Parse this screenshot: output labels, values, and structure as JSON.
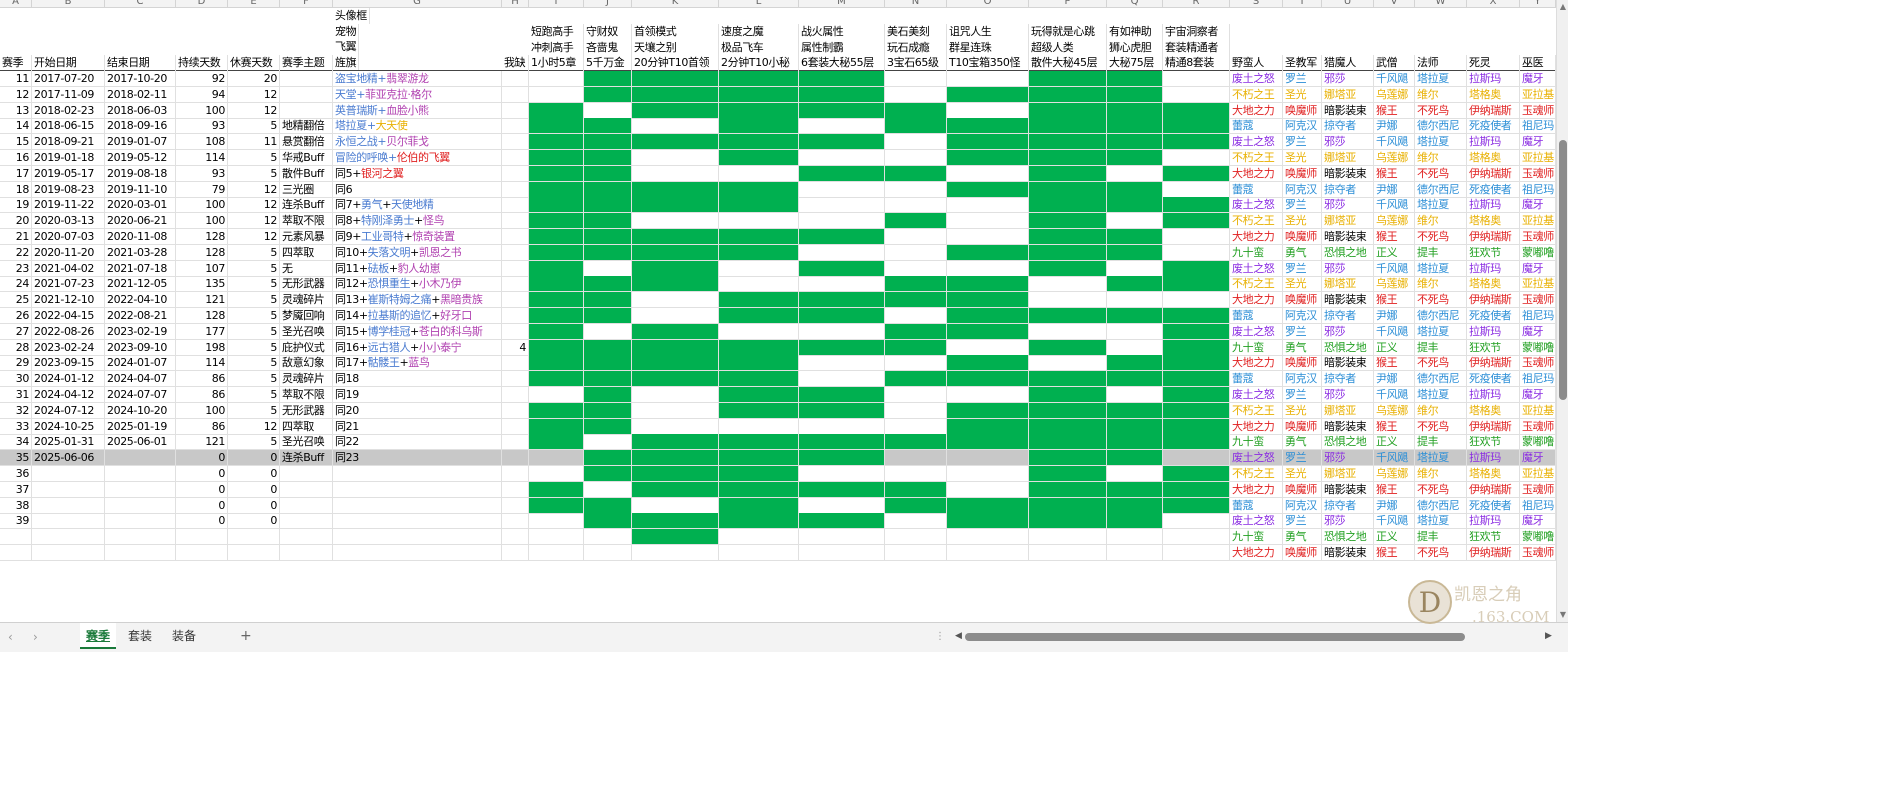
{
  "column_letters": [
    "",
    "A",
    "B",
    "C",
    "D",
    "E",
    "F",
    "G",
    "H",
    "I",
    "J",
    "K",
    "L",
    "M",
    "N",
    "O",
    "P",
    "Q",
    "R",
    "S",
    "T",
    "U",
    "V",
    "W",
    "X",
    "Y"
  ],
  "header_stack": {
    "top": {
      "text": "头像框",
      "color": "#4a7bd0"
    },
    "mid1": {
      "text": "宠物",
      "color": "#b040b0"
    },
    "mid2": {
      "text": "飞翼",
      "color": "#e02020"
    },
    "bottom": {
      "text": "旌旗",
      "color": "#e8b000"
    }
  },
  "headers": {
    "A": "赛季",
    "B": "开始日期",
    "C": "结束日期",
    "D": "持续天数",
    "E": "休赛天数",
    "F": "赛季主题",
    "H": "我缺",
    "I": [
      "短跑高手",
      "冲刺高手",
      "1小时5章"
    ],
    "J": [
      "守财奴",
      "吝啬鬼",
      "5千万金"
    ],
    "K": [
      "首领模式",
      "天壤之别",
      "20分钟T10首领"
    ],
    "L": [
      "速度之魔",
      "极品飞车",
      "2分钟T10小秘"
    ],
    "M": [
      "战火属性",
      "属性制霸",
      "6套装大秘55层"
    ],
    "N": [
      "美石美刻",
      "玩石成瘾",
      "3宝石65级"
    ],
    "O": [
      "诅咒人生",
      "群星连珠",
      "T10宝箱350怪"
    ],
    "P": [
      "玩得就是心跳",
      "超级人类",
      "散件大秘45层"
    ],
    "Q": [
      "有如神助",
      "狮心虎胆",
      "大秘75层"
    ],
    "R": [
      "宇宙洞察者",
      "套装精通者",
      "精通8套装"
    ],
    "S": "野蛮人",
    "T": "圣教军",
    "U": "猎魔人",
    "V": "武僧",
    "W": "法师",
    "X": "死灵",
    "Y": "巫医"
  },
  "rows": [
    {
      "no": "11",
      "start": "2017-07-20",
      "end": "2017-10-20",
      "dur": "92",
      "rest": "20",
      "theme": "",
      "rew": [
        {
          "t": "盗宝地精",
          "c": "#4a7bd0"
        },
        {
          "t": "+",
          "c": "#4a7bd0"
        },
        {
          "t": "翡翠游龙",
          "c": "#b040b0"
        }
      ],
      "h": ""
    },
    {
      "no": "12",
      "start": "2017-11-09",
      "end": "2018-02-11",
      "dur": "94",
      "rest": "12",
      "theme": "",
      "rew": [
        {
          "t": "天堂",
          "c": "#4a7bd0"
        },
        {
          "t": "+",
          "c": "#4a7bd0"
        },
        {
          "t": "菲亚克拉·格尔",
          "c": "#b040b0"
        }
      ],
      "h": ""
    },
    {
      "no": "13",
      "start": "2018-02-23",
      "end": "2018-06-03",
      "dur": "100",
      "rest": "12",
      "theme": "",
      "rew": [
        {
          "t": "英普瑞斯",
          "c": "#4a7bd0"
        },
        {
          "t": "+",
          "c": "#4a7bd0"
        },
        {
          "t": "血脸小熊",
          "c": "#b040b0"
        }
      ],
      "h": ""
    },
    {
      "no": "14",
      "start": "2018-06-15",
      "end": "2018-09-16",
      "dur": "93",
      "rest": "5",
      "theme": "地精翻倍",
      "rew": [
        {
          "t": "塔拉夏",
          "c": "#4a7bd0"
        },
        {
          "t": "+",
          "c": "#4a7bd0"
        },
        {
          "t": "大天使",
          "c": "#e8b000"
        }
      ],
      "h": ""
    },
    {
      "no": "15",
      "start": "2018-09-21",
      "end": "2019-01-07",
      "dur": "108",
      "rest": "11",
      "theme": "悬赏翻倍",
      "rew": [
        {
          "t": "永恒之战",
          "c": "#4a7bd0"
        },
        {
          "t": "+",
          "c": "#4a7bd0"
        },
        {
          "t": "贝尔菲戈",
          "c": "#b040b0"
        }
      ],
      "h": ""
    },
    {
      "no": "16",
      "start": "2019-01-18",
      "end": "2019-05-12",
      "dur": "114",
      "rest": "5",
      "theme": "华戒Buff",
      "rew": [
        {
          "t": "冒险的呼唤",
          "c": "#4a7bd0"
        },
        {
          "t": "+",
          "c": "#4a7bd0"
        },
        {
          "t": "伦伯的飞翼",
          "c": "#e02020"
        }
      ],
      "h": ""
    },
    {
      "no": "17",
      "start": "2019-05-17",
      "end": "2019-08-18",
      "dur": "93",
      "rest": "5",
      "theme": "散件Buff",
      "rew": [
        {
          "t": "同5",
          "c": "#000"
        },
        {
          "t": "+",
          "c": "#000"
        },
        {
          "t": "银河之翼",
          "c": "#e02020"
        }
      ],
      "h": ""
    },
    {
      "no": "18",
      "start": "2019-08-23",
      "end": "2019-11-10",
      "dur": "79",
      "rest": "12",
      "theme": "三光圈",
      "rew": [
        {
          "t": "同6",
          "c": "#000"
        }
      ],
      "h": ""
    },
    {
      "no": "19",
      "start": "2019-11-22",
      "end": "2020-03-01",
      "dur": "100",
      "rest": "12",
      "theme": "连杀Buff",
      "rew": [
        {
          "t": "同7",
          "c": "#000"
        },
        {
          "t": "+",
          "c": "#000"
        },
        {
          "t": "勇气",
          "c": "#4a7bd0"
        },
        {
          "t": "+",
          "c": "#000"
        },
        {
          "t": "天使地精",
          "c": "#4a7bd0"
        }
      ],
      "h": ""
    },
    {
      "no": "20",
      "start": "2020-03-13",
      "end": "2020-06-21",
      "dur": "100",
      "rest": "12",
      "theme": "萃取不限",
      "rew": [
        {
          "t": "同8",
          "c": "#000"
        },
        {
          "t": "+",
          "c": "#000"
        },
        {
          "t": "特刚泽勇士",
          "c": "#4a7bd0"
        },
        {
          "t": "+",
          "c": "#000"
        },
        {
          "t": "怪鸟",
          "c": "#b040b0"
        }
      ],
      "h": ""
    },
    {
      "no": "21",
      "start": "2020-07-03",
      "end": "2020-11-08",
      "dur": "128",
      "rest": "12",
      "theme": "元素风暴",
      "rew": [
        {
          "t": "同9",
          "c": "#000"
        },
        {
          "t": "+",
          "c": "#000"
        },
        {
          "t": "工业哥特",
          "c": "#4a7bd0"
        },
        {
          "t": "+",
          "c": "#000"
        },
        {
          "t": "惊奇装置",
          "c": "#b040b0"
        }
      ],
      "h": ""
    },
    {
      "no": "22",
      "start": "2020-11-20",
      "end": "2021-03-28",
      "dur": "128",
      "rest": "5",
      "theme": "四萃取",
      "rew": [
        {
          "t": "同10",
          "c": "#000"
        },
        {
          "t": "+",
          "c": "#000"
        },
        {
          "t": "失落文明",
          "c": "#4a7bd0"
        },
        {
          "t": "+",
          "c": "#000"
        },
        {
          "t": "凯恩之书",
          "c": "#b040b0"
        }
      ],
      "h": ""
    },
    {
      "no": "23",
      "start": "2021-04-02",
      "end": "2021-07-18",
      "dur": "107",
      "rest": "5",
      "theme": "无",
      "rew": [
        {
          "t": "同11",
          "c": "#000"
        },
        {
          "t": "+",
          "c": "#000"
        },
        {
          "t": "砝板",
          "c": "#4a7bd0"
        },
        {
          "t": "+",
          "c": "#000"
        },
        {
          "t": "豹人幼崽",
          "c": "#b040b0"
        }
      ],
      "h": ""
    },
    {
      "no": "24",
      "start": "2021-07-23",
      "end": "2021-12-05",
      "dur": "135",
      "rest": "5",
      "theme": "无形武器",
      "rew": [
        {
          "t": "同12",
          "c": "#000"
        },
        {
          "t": "+",
          "c": "#000"
        },
        {
          "t": "恐惧重生",
          "c": "#4a7bd0"
        },
        {
          "t": "+",
          "c": "#000"
        },
        {
          "t": "小木乃伊",
          "c": "#b040b0"
        }
      ],
      "h": ""
    },
    {
      "no": "25",
      "start": "2021-12-10",
      "end": "2022-04-10",
      "dur": "121",
      "rest": "5",
      "theme": "灵魂碎片",
      "rew": [
        {
          "t": "同13",
          "c": "#000"
        },
        {
          "t": "+",
          "c": "#000"
        },
        {
          "t": "崔斯特姆之痛",
          "c": "#4a7bd0"
        },
        {
          "t": "+",
          "c": "#000"
        },
        {
          "t": "黑暗贵族",
          "c": "#b040b0"
        }
      ],
      "h": ""
    },
    {
      "no": "26",
      "start": "2022-04-15",
      "end": "2022-08-21",
      "dur": "128",
      "rest": "5",
      "theme": "梦魇回响",
      "rew": [
        {
          "t": "同14",
          "c": "#000"
        },
        {
          "t": "+",
          "c": "#000"
        },
        {
          "t": "拉基斯的追忆",
          "c": "#4a7bd0"
        },
        {
          "t": "+",
          "c": "#000"
        },
        {
          "t": "好牙口",
          "c": "#b040b0"
        }
      ],
      "h": ""
    },
    {
      "no": "27",
      "start": "2022-08-26",
      "end": "2023-02-19",
      "dur": "177",
      "rest": "5",
      "theme": "圣光召唤",
      "rew": [
        {
          "t": "同15",
          "c": "#000"
        },
        {
          "t": "+",
          "c": "#000"
        },
        {
          "t": "博学桂冠",
          "c": "#4a7bd0"
        },
        {
          "t": "+",
          "c": "#000"
        },
        {
          "t": "苍白的科乌斯",
          "c": "#b040b0"
        }
      ],
      "h": ""
    },
    {
      "no": "28",
      "start": "2023-02-24",
      "end": "2023-09-10",
      "dur": "198",
      "rest": "5",
      "theme": "庇护仪式",
      "rew": [
        {
          "t": "同16",
          "c": "#000"
        },
        {
          "t": "+",
          "c": "#000"
        },
        {
          "t": "远古猎人",
          "c": "#4a7bd0"
        },
        {
          "t": "+",
          "c": "#000"
        },
        {
          "t": "小小泰宁",
          "c": "#b040b0"
        }
      ],
      "h": "4"
    },
    {
      "no": "29",
      "start": "2023-09-15",
      "end": "2024-01-07",
      "dur": "114",
      "rest": "5",
      "theme": "敌意幻象",
      "rew": [
        {
          "t": "同17",
          "c": "#000"
        },
        {
          "t": "+",
          "c": "#000"
        },
        {
          "t": "骷髅王",
          "c": "#4a7bd0"
        },
        {
          "t": "+",
          "c": "#000"
        },
        {
          "t": "蓝鸟",
          "c": "#b040b0"
        }
      ],
      "h": ""
    },
    {
      "no": "30",
      "start": "2024-01-12",
      "end": "2024-04-07",
      "dur": "86",
      "rest": "5",
      "theme": "灵魂碎片",
      "rew": [
        {
          "t": "同18",
          "c": "#000"
        }
      ],
      "h": ""
    },
    {
      "no": "31",
      "start": "2024-04-12",
      "end": "2024-07-07",
      "dur": "86",
      "rest": "5",
      "theme": "萃取不限",
      "rew": [
        {
          "t": "同19",
          "c": "#000"
        }
      ],
      "h": ""
    },
    {
      "no": "32",
      "start": "2024-07-12",
      "end": "2024-10-20",
      "dur": "100",
      "rest": "5",
      "theme": "无形武器",
      "rew": [
        {
          "t": "同20",
          "c": "#000"
        }
      ],
      "h": ""
    },
    {
      "no": "33",
      "start": "2024-10-25",
      "end": "2025-01-19",
      "dur": "86",
      "rest": "12",
      "theme": "四萃取",
      "rew": [
        {
          "t": "同21",
          "c": "#000"
        }
      ],
      "h": ""
    },
    {
      "no": "34",
      "start": "2025-01-31",
      "end": "2025-06-01",
      "dur": "121",
      "rest": "5",
      "theme": "圣光召唤",
      "rew": [
        {
          "t": "同22",
          "c": "#000"
        }
      ],
      "h": ""
    },
    {
      "no": "35",
      "start": "2025-06-06",
      "end": "",
      "dur": "0",
      "rest": "0",
      "theme": "连杀Buff",
      "rew": [
        {
          "t": "同23",
          "c": "#000"
        }
      ],
      "h": ""
    },
    {
      "no": "36",
      "start": "",
      "end": "",
      "dur": "0",
      "rest": "0",
      "theme": "",
      "rew": [],
      "h": ""
    },
    {
      "no": "37",
      "start": "",
      "end": "",
      "dur": "0",
      "rest": "0",
      "theme": "",
      "rew": [],
      "h": ""
    },
    {
      "no": "38",
      "start": "",
      "end": "",
      "dur": "0",
      "rest": "0",
      "theme": "",
      "rew": [],
      "h": ""
    },
    {
      "no": "39",
      "start": "",
      "end": "",
      "dur": "0",
      "rest": "0",
      "theme": "",
      "rew": [],
      "h": ""
    },
    {
      "no": "",
      "start": "",
      "end": "",
      "dur": "",
      "rest": "",
      "theme": "",
      "rew": [],
      "h": ""
    },
    {
      "no": "",
      "start": "",
      "end": "",
      "dur": "",
      "rest": "",
      "theme": "",
      "rew": [],
      "h": ""
    }
  ],
  "selected_row_index": 24,
  "greens": [
    "0111100110",
    "0111101110",
    "1011110111",
    "1101011111",
    "1111101111",
    "1101001110",
    "1100110101",
    "1111001110",
    "1111000111",
    "1100010101",
    "1111100110",
    "1111001110",
    "1010100101",
    "1110011011",
    "1101111000",
    "1101101111",
    "1010011001",
    "1111110101",
    "1111001011",
    "1111011111",
    "0101100101",
    "1101101111",
    "1100001111",
    "1011111111",
    "0111100110",
    "0111000101",
    "1011110111",
    "1101011111",
    "0111101110",
    "0010000000",
    "0000000000"
  ],
  "class_sets": [
    [
      "废土之怒",
      "罗兰",
      "邪莎",
      "千风飓",
      "塔拉夏",
      "拉斯玛",
      "魔牙"
    ],
    [
      "不朽之王",
      "圣光",
      "娜塔亚",
      "乌莲娜",
      "维尔",
      "塔格奥",
      "亚拉基"
    ],
    [
      "大地之力",
      "唤魔师",
      "暗影装束",
      "猴王",
      "不死鸟",
      "伊纳瑞斯",
      "玉魂师"
    ],
    [
      "蕾蔻",
      "阿克汉",
      "掠夺者",
      "尹娜",
      "德尔西尼",
      "死疫使者",
      "祖尼玛"
    ],
    [
      "九十蛮",
      "勇气",
      "恐惧之地",
      "正义",
      "提丰",
      "狂欢节",
      "蒙嘟噜"
    ]
  ],
  "class_cycle": [
    0,
    1,
    2,
    3,
    0,
    1,
    2,
    3,
    0,
    1,
    2,
    4,
    0,
    1,
    2,
    3,
    0,
    4,
    2,
    3,
    0,
    1,
    2,
    4,
    0,
    1,
    2,
    3,
    0,
    4,
    2
  ],
  "class_colors": [
    [
      "#8a2be2",
      "#2b8ed6",
      "#8a2be2",
      "#2b8ed6",
      "#2b8ed6",
      "#8a2be2",
      "#8a2be2"
    ],
    [
      "#e8b000",
      "#e8b000",
      "#e8b000",
      "#e8b000",
      "#e8b000",
      "#e8b000",
      "#e8b000"
    ],
    [
      "#e02020",
      "#e02020",
      "#000",
      "#e02020",
      "#e02020",
      "#e02020",
      "#e02020"
    ],
    [
      "#2b8ed6",
      "#2b8ed6",
      "#2b8ed6",
      "#2b8ed6",
      "#2b8ed6",
      "#2b8ed6",
      "#2b8ed6"
    ],
    [
      "#22a022",
      "#22a022",
      "#22a022",
      "#22a022",
      "#22a022",
      "#22a022",
      "#22a022"
    ]
  ],
  "tabs": [
    {
      "label": "赛季",
      "active": true
    },
    {
      "label": "套装",
      "active": false
    },
    {
      "label": "装备",
      "active": false
    }
  ],
  "add_tab_label": "+",
  "watermark": {
    "logo_text": "凯恩之角",
    "domain": ".163.COM",
    "letter": "D"
  },
  "accent_green": "#00b050",
  "selection_color": "#217346"
}
